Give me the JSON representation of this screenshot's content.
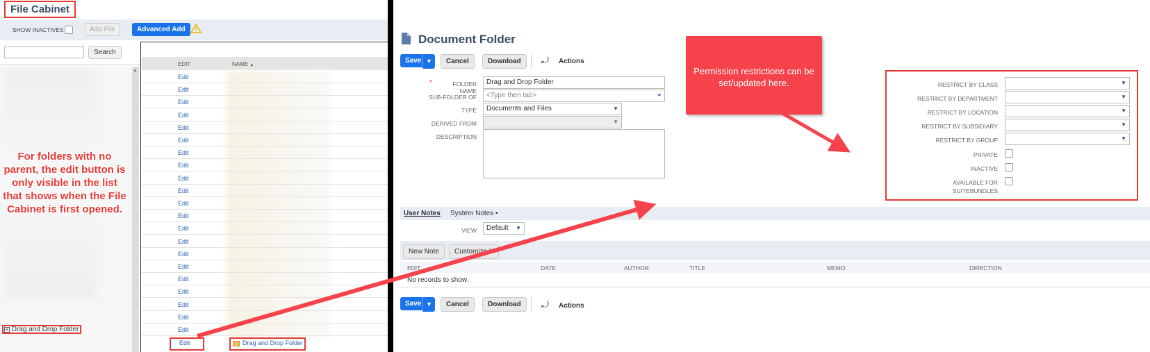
{
  "left": {
    "title": "File Cabinet",
    "show_inactives_label": "SHOW INACTIVES",
    "add_file_label": "Add File",
    "advanced_add_label": "Advanced Add",
    "search_placeholder": "",
    "search_button": "Search",
    "columns": [
      "EDIT",
      "NAME"
    ],
    "edit_label": "Edit",
    "tree_item": "Drag and Drop Folder",
    "highlight_row": {
      "edit": "Edit",
      "name": "Drag and Drop Folder"
    },
    "annotation": "For folders with no parent, the edit button is only visible in the list that shows when the File Cabinet is first opened."
  },
  "right": {
    "title": "Document Folder",
    "buttons": {
      "save": "Save",
      "cancel": "Cancel",
      "download": "Download",
      "actions": "Actions"
    },
    "form": {
      "folder_name_label": "FOLDER NAME",
      "folder_name_value": "Drag and Drop Folder",
      "sub_folder_label": "SUB-FOLDER OF",
      "sub_folder_placeholder": "<Type then tab>",
      "type_label": "TYPE",
      "type_value": "Documents and Files",
      "derived_label": "DERIVED FROM",
      "description_label": "DESCRIPTION"
    },
    "callout": "Permission restrictions can be set/updated here.",
    "restrictions": {
      "class": "RESTRICT BY CLASS",
      "department": "RESTRICT BY DEPARTMENT",
      "location": "RESTRICT BY LOCATION",
      "subsidiary": "RESTRICT BY SUBSIDIARY",
      "group": "RESTRICT BY GROUP",
      "private": "PRIVATE",
      "inactive": "INACTIVE",
      "available1": "AVAILABLE FOR",
      "available2": "SUITEBUNDLES"
    },
    "tabs": {
      "user_notes": "User Notes",
      "system_notes": "System Notes •"
    },
    "view_label": "VIEW",
    "view_value": "Default",
    "new_note": "New Note",
    "customize": "Customize V",
    "table_cols": [
      "EDIT",
      "DATE",
      "AUTHOR",
      "TITLE",
      "MEMO",
      "DIRECTION"
    ],
    "no_records": "No records to show."
  },
  "colors": {
    "accent": "#1a73e8",
    "annotation": "#e53935",
    "callout": "#f5424b",
    "title": "#3a4b63"
  }
}
